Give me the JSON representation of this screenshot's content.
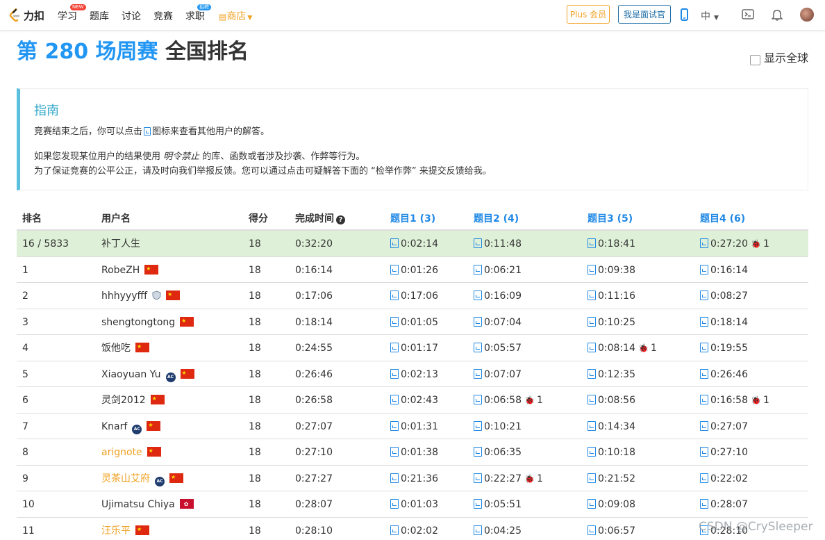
{
  "nav": {
    "logo_text": "力扣",
    "items": [
      {
        "label": "学习",
        "badge": "NEW",
        "badge_color": "#f44336"
      },
      {
        "label": "题库"
      },
      {
        "label": "讨论"
      },
      {
        "label": "竞赛"
      },
      {
        "label": "求职",
        "badge": "招聘",
        "badge_color": "#2196f3"
      },
      {
        "label": "商店"
      }
    ],
    "plus_label": "Plus 会员",
    "interviewer_label": "我是面试官",
    "lang_label": "中",
    "icons": [
      "phone-icon",
      "terminal-icon",
      "bell-icon",
      "avatar"
    ]
  },
  "title": {
    "part1": "第 280 场周赛",
    "part2": "全国排名"
  },
  "show_global_label": "显示全球",
  "guide": {
    "title": "指南",
    "line1_a": "竞赛结束之后，你可以点击",
    "line1_b": "图标来查看其他用户的解答。",
    "line2_a": "如果您发现某位用户的结果使用",
    "line2_em": "明令禁止",
    "line2_b": "的库、函数或者涉及抄袭、作弊等行为。",
    "line3": "为了保证竞赛的公平公正，请及时向我们举报反馈。您可以通过点击可疑解答下面的 “检举作弊” 来提交反馈给我。"
  },
  "table": {
    "headers": {
      "rank": "排名",
      "user": "用户名",
      "score": "得分",
      "time": "完成时间",
      "q1": "题目1 (3)",
      "q2": "题目2 (4)",
      "q3": "题目3 (5)",
      "q4": "题目4 (6)"
    },
    "rows": [
      {
        "rank": "16 / 5833",
        "user": "补丁人生",
        "score": "18",
        "time": "0:32:20",
        "q1": "0:02:14",
        "q2": "0:11:48",
        "q3": "0:18:41",
        "q4": "0:27:20",
        "q4_bug": "1"
      },
      {
        "rank": "1",
        "user": "RobeZH",
        "score": "18",
        "time": "0:16:14",
        "q1": "0:01:26",
        "q2": "0:06:21",
        "q3": "0:09:38",
        "q4": "0:16:14"
      },
      {
        "rank": "2",
        "user": "hhhyyyfff",
        "score": "18",
        "time": "0:17:06",
        "q1": "0:17:06",
        "q2": "0:16:09",
        "q3": "0:11:16",
        "q4": "0:08:27"
      },
      {
        "rank": "3",
        "user": "shengtongtong",
        "score": "18",
        "time": "0:18:14",
        "q1": "0:01:05",
        "q2": "0:07:04",
        "q3": "0:10:25",
        "q4": "0:18:14"
      },
      {
        "rank": "4",
        "user": "饭他吃",
        "score": "18",
        "time": "0:24:55",
        "q1": "0:01:17",
        "q2": "0:05:57",
        "q3": "0:08:14",
        "q3_bug": "1",
        "q4": "0:19:55"
      },
      {
        "rank": "5",
        "user": "Xiaoyuan Yu",
        "score": "18",
        "time": "0:26:46",
        "q1": "0:02:13",
        "q2": "0:07:07",
        "q3": "0:12:35",
        "q4": "0:26:46"
      },
      {
        "rank": "6",
        "user": "灵剑2012",
        "score": "18",
        "time": "0:26:58",
        "q1": "0:02:43",
        "q2": "0:06:58",
        "q2_bug": "1",
        "q3": "0:08:56",
        "q4": "0:16:58",
        "q4_bug": "1"
      },
      {
        "rank": "7",
        "user": "Knarf",
        "score": "18",
        "time": "0:27:07",
        "q1": "0:01:31",
        "q2": "0:10:21",
        "q3": "0:14:34",
        "q4": "0:27:07"
      },
      {
        "rank": "8",
        "user": "arignote",
        "score": "18",
        "time": "0:27:10",
        "q1": "0:01:38",
        "q2": "0:06:35",
        "q3": "0:10:18",
        "q4": "0:27:10"
      },
      {
        "rank": "9",
        "user": "灵茶山艾府",
        "score": "18",
        "time": "0:27:27",
        "q1": "0:21:36",
        "q2": "0:22:27",
        "q2_bug": "1",
        "q3": "0:21:52",
        "q4": "0:22:02"
      },
      {
        "rank": "10",
        "user": "Ujimatsu Chiya",
        "score": "18",
        "time": "0:28:07",
        "q1": "0:01:03",
        "q2": "0:05:51",
        "q3": "0:09:08",
        "q4": "0:28:07"
      },
      {
        "rank": "11",
        "user": "汪乐平",
        "score": "18",
        "time": "0:28:10",
        "q1": "0:02:02",
        "q2": "0:04:25",
        "q3": "0:06:57",
        "q4": "0:28:10"
      }
    ]
  },
  "watermark": "CSDN @CrySleeper"
}
